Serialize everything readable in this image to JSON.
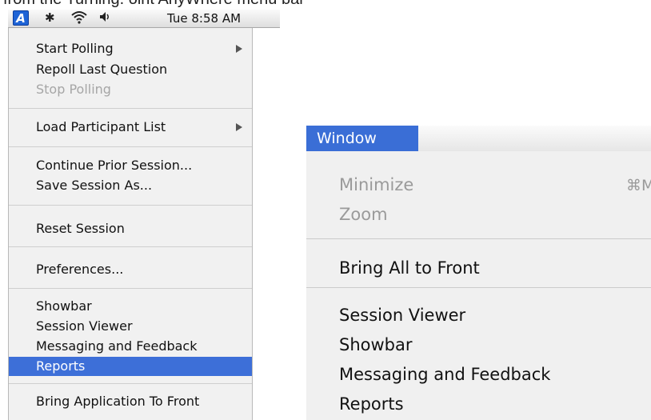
{
  "caption": "from the Turning. oint AnyWhere menu bar",
  "menubar": {
    "app_icon_glyph": "A",
    "clock": "Tue 8:58 AM",
    "icons": [
      "app-icon",
      "bluetooth-icon",
      "wifi-icon",
      "volume-icon"
    ]
  },
  "dropdown": {
    "items": [
      {
        "label": "Start Polling",
        "state": "enabled",
        "submenu": true
      },
      {
        "label": "Repoll Last Question",
        "state": "enabled"
      },
      {
        "label": "Stop Polling",
        "state": "disabled"
      },
      {
        "label": "Load Participant List",
        "state": "enabled",
        "submenu": true
      },
      {
        "label": "Continue Prior Session...",
        "state": "enabled"
      },
      {
        "label": "Save Session As...",
        "state": "enabled"
      },
      {
        "label": "Reset Session",
        "state": "enabled"
      },
      {
        "label": "Preferences...",
        "state": "enabled"
      },
      {
        "label": "Showbar",
        "state": "enabled"
      },
      {
        "label": "Session Viewer",
        "state": "enabled"
      },
      {
        "label": "Messaging and Feedback",
        "state": "enabled"
      },
      {
        "label": "Reports",
        "state": "selected"
      },
      {
        "label": "Bring Application To Front",
        "state": "enabled"
      }
    ],
    "colors": {
      "highlight": "#3d6fd8",
      "disabled_text": "#a6a6a6"
    }
  },
  "window_menu": {
    "title": "Window",
    "items": [
      {
        "label": "Minimize",
        "shortcut": "⌘M",
        "state": "disabled"
      },
      {
        "label": "Zoom",
        "state": "disabled"
      },
      {
        "label": "Bring All to Front",
        "state": "enabled"
      },
      {
        "label": "Session Viewer",
        "state": "enabled"
      },
      {
        "label": "Showbar",
        "state": "enabled"
      },
      {
        "label": "Messaging and Feedback",
        "state": "enabled"
      },
      {
        "label": "Reports",
        "state": "enabled"
      }
    ],
    "colors": {
      "title_highlight": "#3a6ed6"
    }
  }
}
